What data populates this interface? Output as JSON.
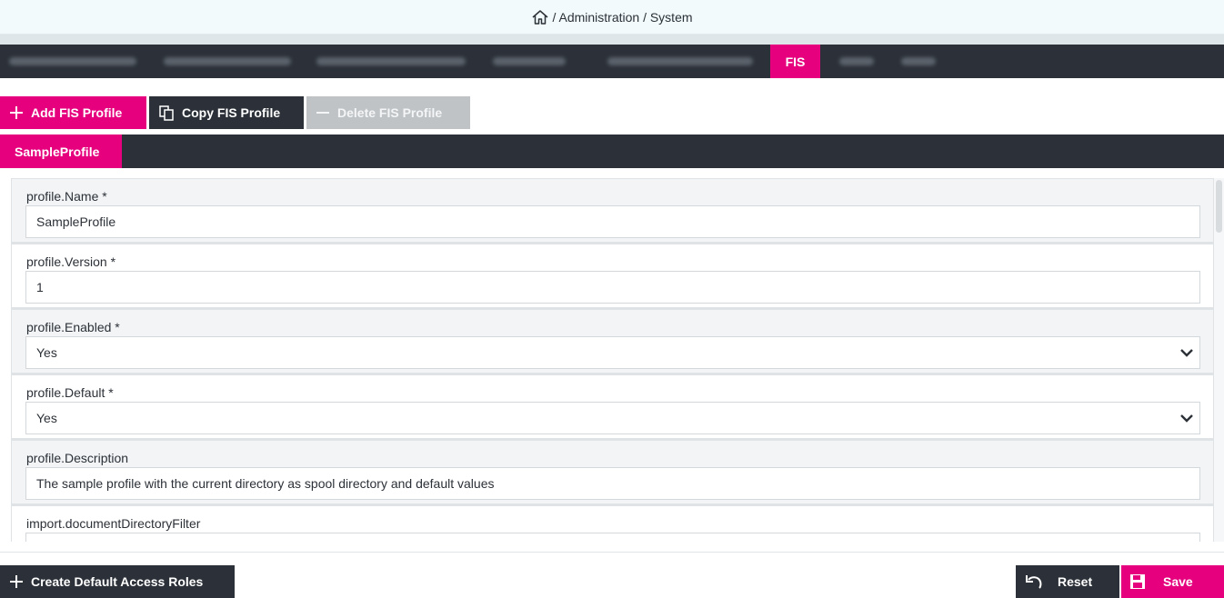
{
  "breadcrumb": {
    "text": "/ Administration / System"
  },
  "topnav": {
    "tabs": [
      {
        "label": "",
        "blurred": true
      },
      {
        "label": "",
        "blurred": true
      },
      {
        "label": "",
        "blurred": true
      },
      {
        "label": "",
        "blurred": true
      },
      {
        "label": "",
        "blurred": true
      },
      {
        "label": "FIS",
        "active": true
      },
      {
        "label": "",
        "blurred": true
      },
      {
        "label": "",
        "blurred": true
      }
    ]
  },
  "toolbar": {
    "add_label": "Add FIS Profile",
    "copy_label": "Copy FIS Profile",
    "delete_label": "Delete FIS Profile"
  },
  "profile_tabs": {
    "active": "SampleProfile"
  },
  "form": {
    "fields": [
      {
        "label": "profile.Name *",
        "value": "SampleProfile",
        "type": "text"
      },
      {
        "label": "profile.Version *",
        "value": "1",
        "type": "text"
      },
      {
        "label": "profile.Enabled *",
        "value": "Yes",
        "type": "select"
      },
      {
        "label": "profile.Default *",
        "value": "Yes",
        "type": "select"
      },
      {
        "label": "profile.Description",
        "value": "The sample profile with the current directory as spool directory and default values",
        "type": "text"
      },
      {
        "label": "import.documentDirectoryFilter",
        "value": "",
        "type": "text"
      }
    ]
  },
  "footer": {
    "create_label": "Create Default Access Roles",
    "reset_label": "Reset",
    "save_label": "Save"
  },
  "colors": {
    "accent": "#e6007e",
    "dark": "#2c3139",
    "disabled": "#bfc3c6"
  }
}
